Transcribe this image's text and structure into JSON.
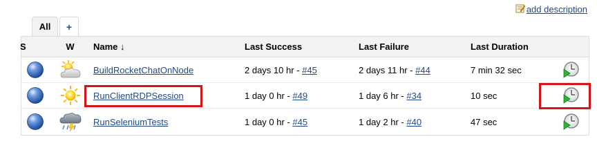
{
  "top": {
    "add_description": "add description"
  },
  "tabs": [
    {
      "label": "All",
      "active": true
    },
    {
      "label": "+",
      "active": false
    }
  ],
  "columns": {
    "status": "S",
    "weather": "W",
    "name": "Name ↓",
    "last_success": "Last Success",
    "last_failure": "Last Failure",
    "last_duration": "Last Duration"
  },
  "jobs": [
    {
      "status_icon": "blue-ball-icon",
      "weather_icon": "partly-cloudy-icon",
      "name": "BuildRocketChatOnNode",
      "last_success_text": "2 days 10 hr - ",
      "last_success_build": "#45",
      "last_failure_text": "2 days 11 hr - ",
      "last_failure_build": "#44",
      "last_duration": "7 min 32 sec"
    },
    {
      "status_icon": "blue-ball-icon",
      "weather_icon": "sunny-icon",
      "name": "RunClientRDPSession",
      "last_success_text": "1 day 0 hr - ",
      "last_success_build": "#49",
      "last_failure_text": "1 day 6 hr - ",
      "last_failure_build": "#34",
      "last_duration": "10 sec"
    },
    {
      "status_icon": "blue-ball-icon",
      "weather_icon": "storm-icon",
      "name": "RunSeleniumTests",
      "last_success_text": "1 day 0 hr - ",
      "last_success_build": "#45",
      "last_failure_text": "1 day 2 hr - ",
      "last_failure_build": "#40",
      "last_duration": "47 sec"
    }
  ],
  "colors": {
    "link": "#204a87",
    "highlight": "#d4151a",
    "header_bg": "#f2f2f2"
  }
}
